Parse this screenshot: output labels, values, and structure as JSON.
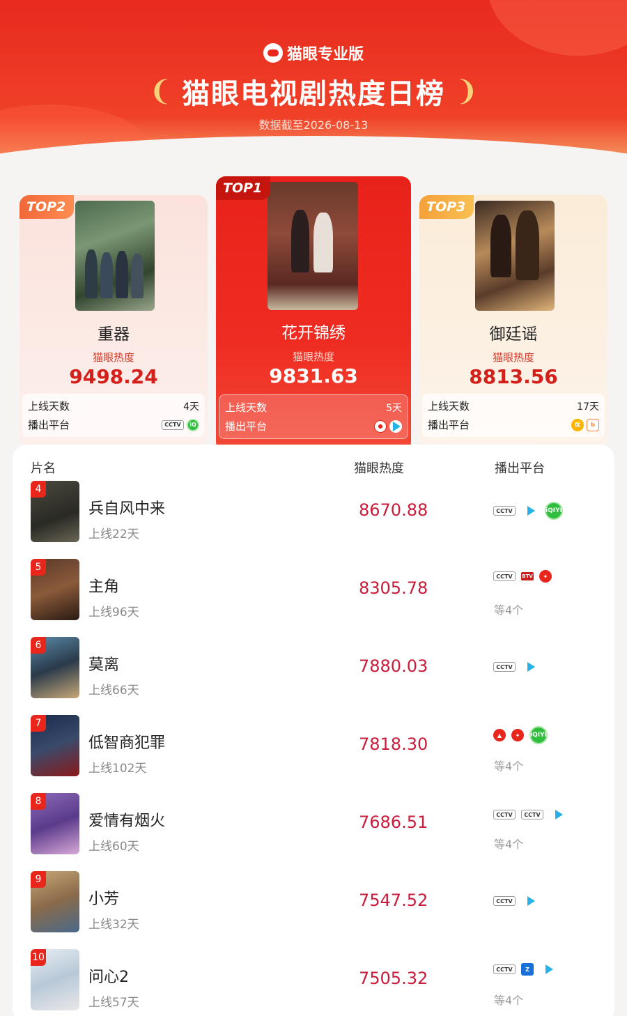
{
  "header": {
    "brand": "猫眼专业版",
    "title": "猫眼电视剧热度日榜",
    "subtitle": "数据截至2026-08-13"
  },
  "top_cards": [
    {
      "badge": "TOP1",
      "name": "花开锦绣",
      "label": "猫眼热度",
      "score": "9831.63",
      "days_label": "上线天数",
      "days": "5天",
      "platform_label": "播出平台",
      "platforms": [
        "mango-icon",
        "tencent-video-icon"
      ]
    },
    {
      "badge": "TOP2",
      "name": "重器",
      "label": "猫眼热度",
      "score": "9498.24",
      "days_label": "上线天数",
      "days": "4天",
      "platform_label": "播出平台",
      "platforms": [
        "cctv-icon",
        "iqiyi-icon"
      ]
    },
    {
      "badge": "TOP3",
      "name": "御廷谣",
      "label": "猫眼热度",
      "score": "8813.56",
      "days_label": "上线天数",
      "days": "17天",
      "platform_label": "播出平台",
      "platforms": [
        "youku-icon",
        "bilibili-icon"
      ]
    }
  ],
  "list": {
    "headers": {
      "name": "片名",
      "heat": "猫眼热度",
      "platform": "播出平台"
    },
    "rows": [
      {
        "rank": "4",
        "name": "兵自风中来",
        "days": "上线22天",
        "score": "8670.88",
        "platforms": [
          "cctv-icon",
          "tencent-video-icon",
          "iqiyi-icon"
        ],
        "more": ""
      },
      {
        "rank": "5",
        "name": "主角",
        "days": "上线96天",
        "score": "8305.78",
        "platforms": [
          "cctv-icon",
          "btv-icon",
          "mango-icon"
        ],
        "more": "等4个"
      },
      {
        "rank": "6",
        "name": "莫离",
        "days": "上线66天",
        "score": "7880.03",
        "platforms": [
          "cctv-icon",
          "tencent-video-icon"
        ],
        "more": ""
      },
      {
        "rank": "7",
        "name": "低智商犯罪",
        "days": "上线102天",
        "score": "7818.30",
        "platforms": [
          "red-icon",
          "mango-icon",
          "iqiyi-icon"
        ],
        "more": "等4个"
      },
      {
        "rank": "8",
        "name": "爱情有烟火",
        "days": "上线60天",
        "score": "7686.51",
        "platforms": [
          "cctv-icon",
          "cctv-icon",
          "tencent-video-icon"
        ],
        "more": "等4个"
      },
      {
        "rank": "9",
        "name": "小芳",
        "days": "上线32天",
        "score": "7547.52",
        "platforms": [
          "cctv-icon",
          "tencent-video-icon"
        ],
        "more": ""
      },
      {
        "rank": "10",
        "name": "问心2",
        "days": "上线57天",
        "score": "7505.32",
        "platforms": [
          "cctv-icon",
          "zhejiang-tv-icon",
          "tencent-video-icon"
        ],
        "more": "等4个"
      }
    ]
  }
}
